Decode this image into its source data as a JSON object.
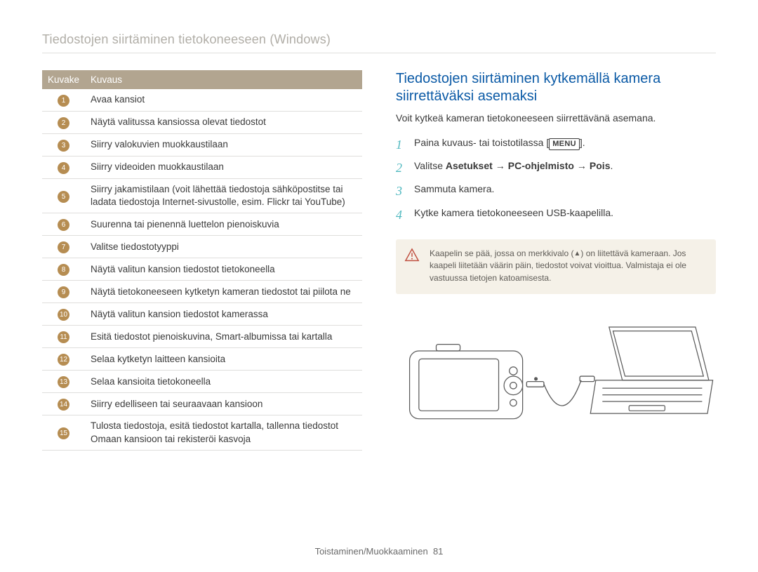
{
  "page_title": "Tiedostojen siirtäminen tietokoneeseen (Windows)",
  "table": {
    "head": {
      "icon": "Kuvake",
      "desc": "Kuvaus"
    },
    "rows": [
      {
        "n": "1",
        "desc": "Avaa kansiot"
      },
      {
        "n": "2",
        "desc": "Näytä valitussa kansiossa olevat tiedostot"
      },
      {
        "n": "3",
        "desc": "Siirry valokuvien muokkaustilaan"
      },
      {
        "n": "4",
        "desc": "Siirry videoiden muokkaustilaan"
      },
      {
        "n": "5",
        "desc": "Siirry jakamistilaan (voit lähettää tiedostoja sähköpostitse tai ladata tiedostoja Internet-sivustolle, esim. Flickr tai YouTube)"
      },
      {
        "n": "6",
        "desc": "Suurenna tai pienennä luettelon pienoiskuvia"
      },
      {
        "n": "7",
        "desc": "Valitse tiedostotyyppi"
      },
      {
        "n": "8",
        "desc": "Näytä valitun kansion tiedostot tietokoneella"
      },
      {
        "n": "9",
        "desc": "Näytä tietokoneeseen kytketyn kameran tiedostot tai piilota ne"
      },
      {
        "n": "10",
        "desc": "Näytä valitun kansion tiedostot kamerassa"
      },
      {
        "n": "11",
        "desc": "Esitä tiedostot pienoiskuvina, Smart-albumissa tai kartalla"
      },
      {
        "n": "12",
        "desc": "Selaa kytketyn laitteen kansioita"
      },
      {
        "n": "13",
        "desc": "Selaa kansioita tietokoneella"
      },
      {
        "n": "14",
        "desc": "Siirry edelliseen tai seuraavaan kansioon"
      },
      {
        "n": "15",
        "desc": "Tulosta tiedostoja, esitä tiedostot kartalla, tallenna tiedostot Omaan kansioon tai rekisteröi kasvoja"
      }
    ]
  },
  "section_title": "Tiedostojen siirtäminen kytkemällä kamera siirrettäväksi asemaksi",
  "intro": "Voit kytkeä kameran tietokoneeseen siirrettävänä asemana.",
  "steps": [
    {
      "n": "1",
      "pre": "Paina kuvaus- tai toistotilassa [",
      "menu": "MENU",
      "post": "]."
    },
    {
      "n": "2",
      "pre": "Valitse ",
      "bold_parts": [
        "Asetukset",
        "PC-ohjelmisto",
        "Pois"
      ],
      "post": "."
    },
    {
      "n": "3",
      "text": "Sammuta kamera."
    },
    {
      "n": "4",
      "text": "Kytke kamera tietokoneeseen USB-kaapelilla."
    }
  ],
  "note": {
    "line1_pre": "Kaapelin se pää, jossa on merkkivalo (",
    "line1_post": ") on liitettävä kameraan. Jos kaapeli liitetään väärin päin, tiedostot voivat vioittua. Valmistaja ei ole vastuussa tietojen katoamisesta."
  },
  "footer": {
    "section": "Toistaminen/Muokkaaminen",
    "page": "81"
  }
}
